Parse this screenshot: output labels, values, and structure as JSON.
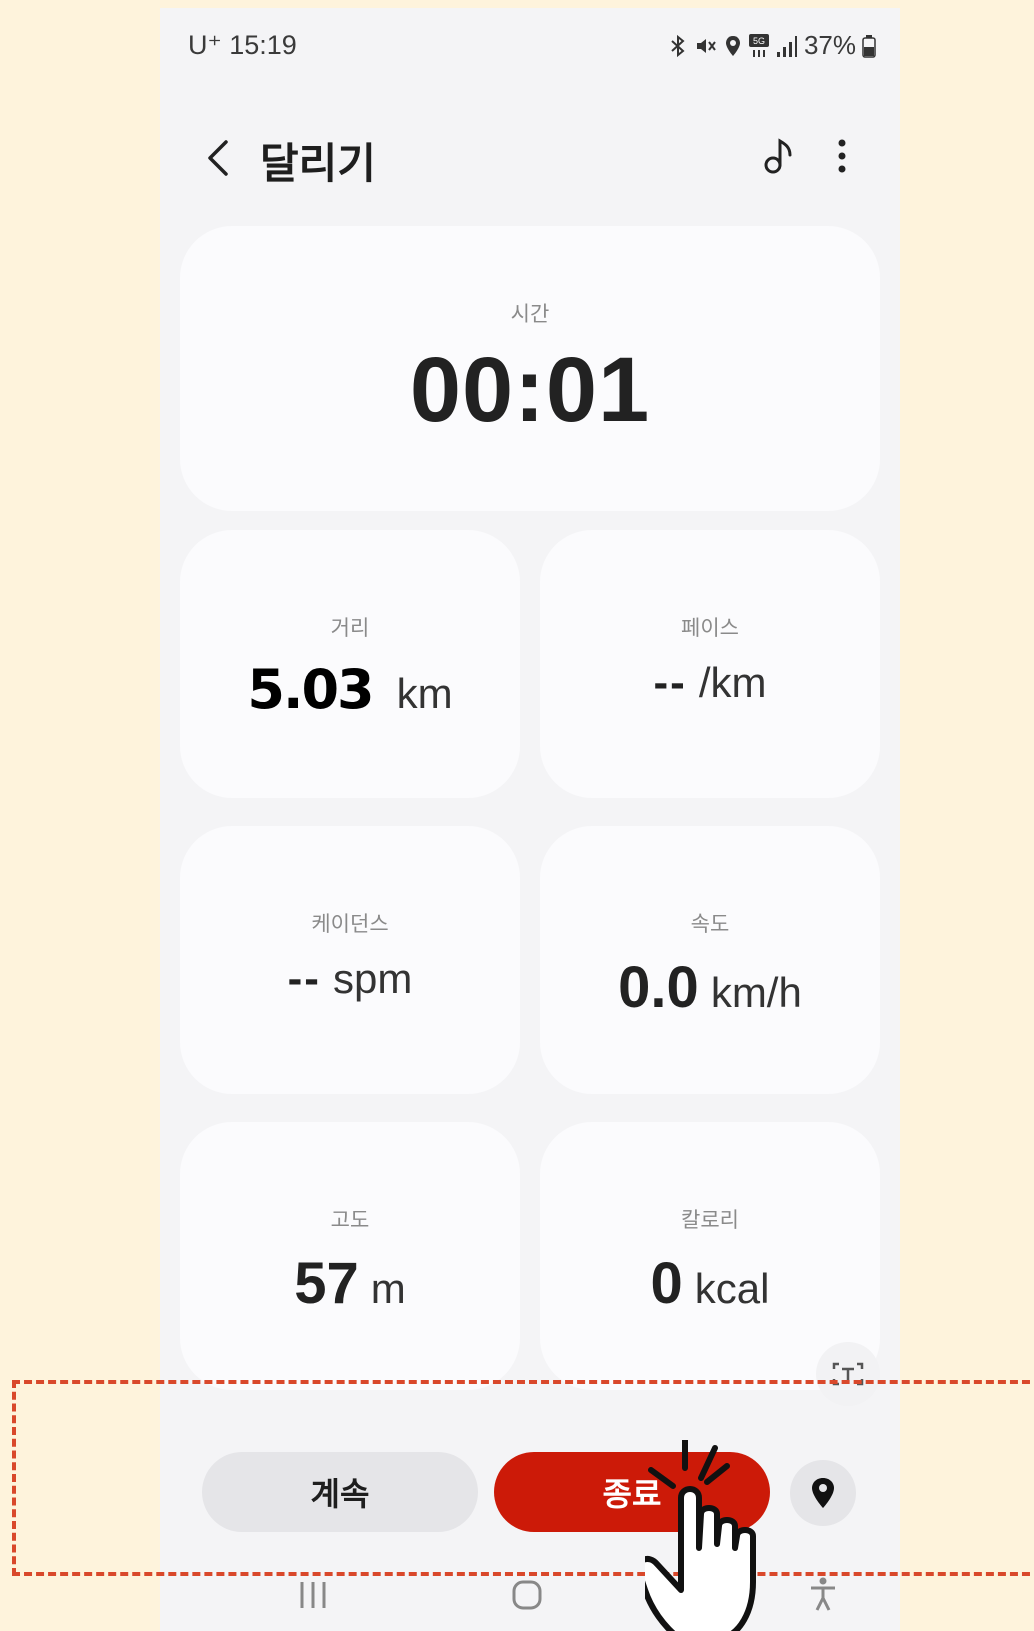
{
  "status_bar": {
    "carrier": "U⁺ 15:19",
    "battery": "37%"
  },
  "header": {
    "title": "달리기"
  },
  "time": {
    "label": "시간",
    "value": "00:01"
  },
  "metrics": {
    "distance": {
      "label": "거리",
      "value": "5.03",
      "unit": "km"
    },
    "pace": {
      "label": "페이스",
      "value": "--",
      "unit": "/km"
    },
    "cadence": {
      "label": "케이던스",
      "value": "--",
      "unit": "spm"
    },
    "speed": {
      "label": "속도",
      "value": "0.0",
      "unit": "km/h"
    },
    "altitude": {
      "label": "고도",
      "value": "57",
      "unit": "m"
    },
    "calories": {
      "label": "칼로리",
      "value": "0",
      "unit": "kcal"
    }
  },
  "actions": {
    "resume_label": "계속",
    "stop_label": "종료"
  },
  "colors": {
    "stop_button": "#cc1a08",
    "highlight_border": "#d9482b",
    "background": "#fef3dc"
  },
  "icons": [
    "back-arrow-icon",
    "music-note-icon",
    "more-vert-icon",
    "text-scan-icon",
    "location-pin-icon",
    "recent-apps-icon",
    "home-icon",
    "accessibility-icon",
    "pointer-hand-icon"
  ]
}
